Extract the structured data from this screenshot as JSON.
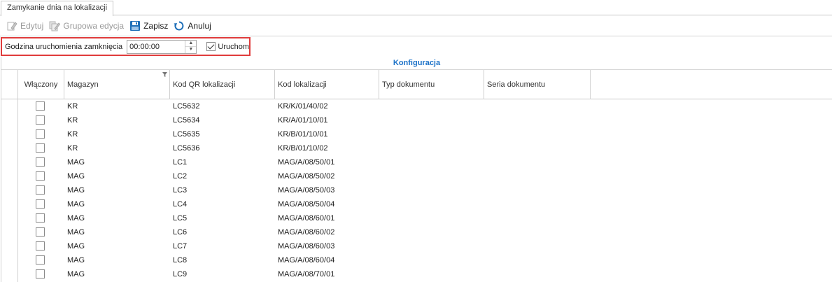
{
  "tab": {
    "title": "Zamykanie dnia na lokalizacji"
  },
  "toolbar": {
    "edit_label": "Edytuj",
    "group_edit_label": "Grupowa edycja",
    "save_label": "Zapisz",
    "cancel_label": "Anuluj"
  },
  "params": {
    "time_label": "Godzina uruchomienia zamknięcia",
    "time_value": "00:00:00",
    "run_label": "Uruchom",
    "run_checked": true
  },
  "grid": {
    "band_title": "Konfiguracja",
    "columns": [
      "Włączony",
      "Magazyn",
      "Kod QR lokalizacji",
      "Kod lokalizacji",
      "Typ dokumentu",
      "Seria dokumentu"
    ],
    "rows": [
      {
        "enabled": false,
        "warehouse": "KR",
        "qr": "LC5632",
        "loc": "KR/K/01/40/02"
      },
      {
        "enabled": false,
        "warehouse": "KR",
        "qr": "LC5634",
        "loc": "KR/A/01/10/01"
      },
      {
        "enabled": false,
        "warehouse": "KR",
        "qr": "LC5635",
        "loc": "KR/B/01/10/01"
      },
      {
        "enabled": false,
        "warehouse": "KR",
        "qr": "LC5636",
        "loc": "KR/B/01/10/02"
      },
      {
        "enabled": false,
        "warehouse": "MAG",
        "qr": "LC1",
        "loc": "MAG/A/08/50/01"
      },
      {
        "enabled": false,
        "warehouse": "MAG",
        "qr": "LC2",
        "loc": "MAG/A/08/50/02"
      },
      {
        "enabled": false,
        "warehouse": "MAG",
        "qr": "LC3",
        "loc": "MAG/A/08/50/03"
      },
      {
        "enabled": false,
        "warehouse": "MAG",
        "qr": "LC4",
        "loc": "MAG/A/08/50/04"
      },
      {
        "enabled": false,
        "warehouse": "MAG",
        "qr": "LC5",
        "loc": "MAG/A/08/60/01"
      },
      {
        "enabled": false,
        "warehouse": "MAG",
        "qr": "LC6",
        "loc": "MAG/A/08/60/02"
      },
      {
        "enabled": false,
        "warehouse": "MAG",
        "qr": "LC7",
        "loc": "MAG/A/08/60/03"
      },
      {
        "enabled": false,
        "warehouse": "MAG",
        "qr": "LC8",
        "loc": "MAG/A/08/60/04"
      },
      {
        "enabled": false,
        "warehouse": "MAG",
        "qr": "LC9",
        "loc": "MAG/A/08/70/01"
      }
    ]
  },
  "colors": {
    "accent": "#1e73c8",
    "highlight_border": "#e03c3c",
    "save_icon": "#1e6fb8"
  },
  "icons": {
    "edit": "pencil-icon",
    "group_edit": "group-edit-icon",
    "save": "floppy-disk-icon",
    "cancel": "undo-icon",
    "filter": "filter-icon"
  }
}
